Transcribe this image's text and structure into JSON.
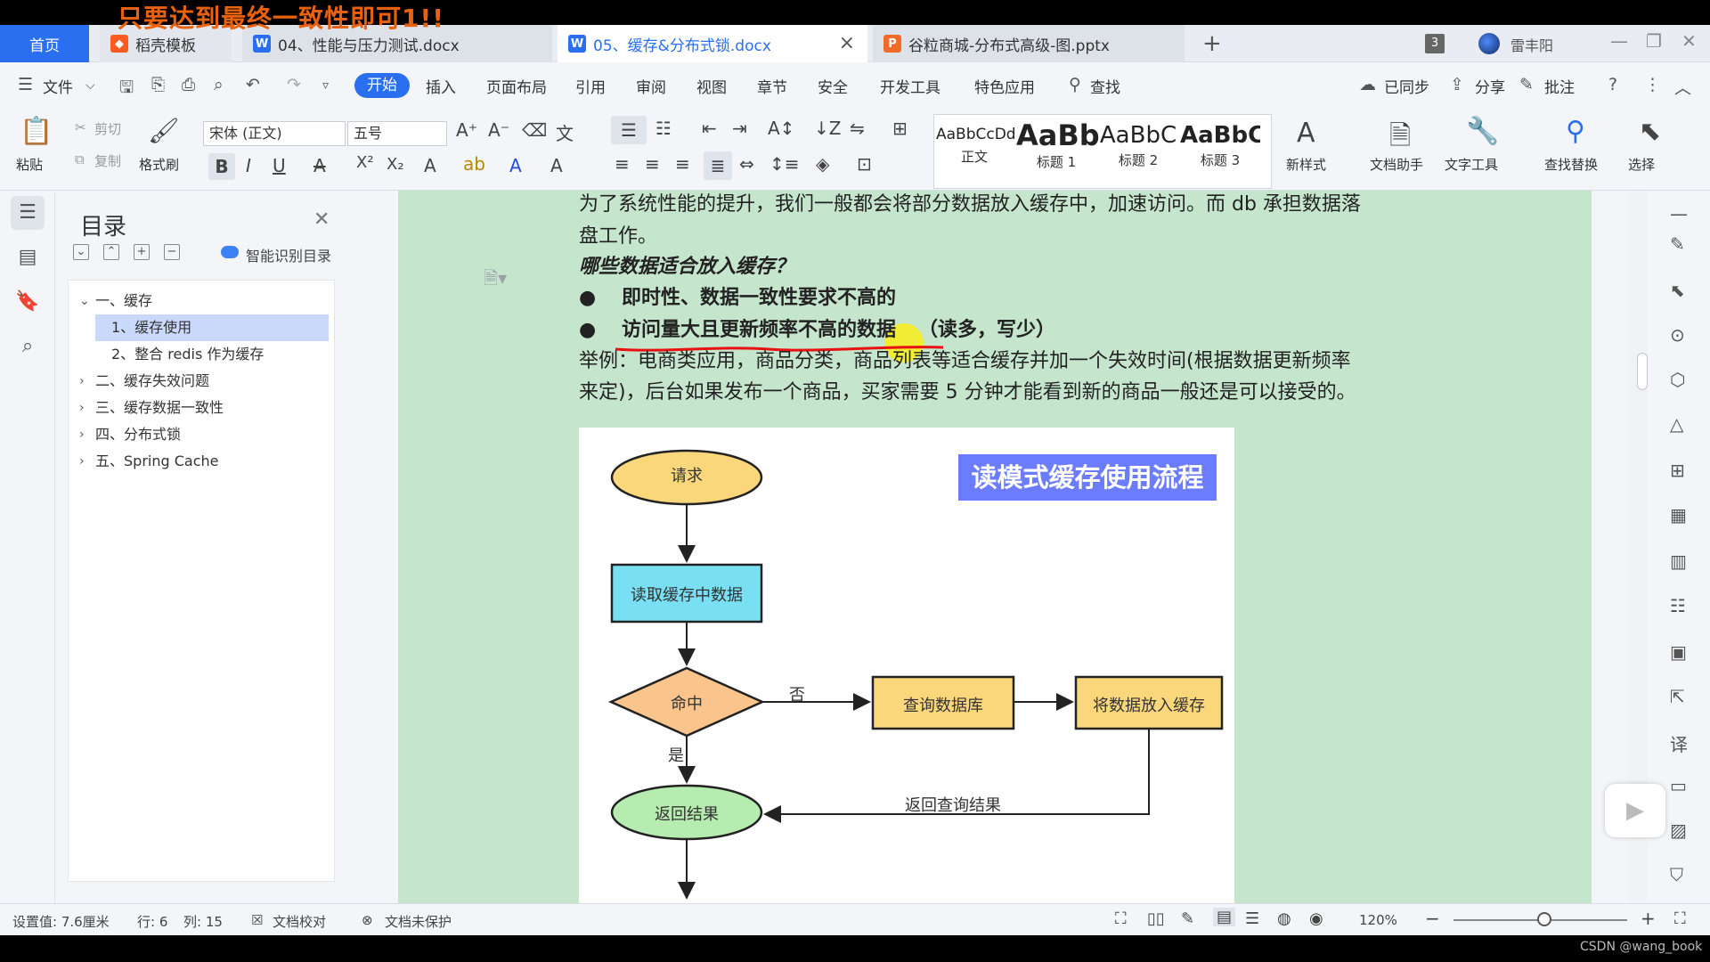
{
  "overlay_text": "只要达到最终一致性即可1!!",
  "tabs": {
    "home": "首页",
    "t1": "稻壳模板",
    "t2": "04、性能与压力测试.docx",
    "t3": "05、缓存&分布式锁.docx",
    "t4": "谷粒商城-分布式高级-图.pptx",
    "count": "3",
    "user": "雷丰阳"
  },
  "menu": {
    "file": "文件",
    "start": "开始",
    "insert": "插入",
    "layout": "页面布局",
    "ref": "引用",
    "review": "审阅",
    "view": "视图",
    "chapter": "章节",
    "security": "安全",
    "devtools": "开发工具",
    "special": "特色应用",
    "search": "查找",
    "synced": "已同步",
    "share": "分享",
    "comment": "批注"
  },
  "ribbon": {
    "paste": "粘贴",
    "cut": "剪切",
    "copy": "复制",
    "format_painter": "格式刷",
    "font_name": "宋体 (正文)",
    "font_size": "五号",
    "styles": [
      {
        "preview": "AaBbCcDd",
        "label": "正文"
      },
      {
        "preview": "AaBb",
        "label": "标题 1"
      },
      {
        "preview": "AaBbC",
        "label": "标题 2"
      },
      {
        "preview": "AaBbC",
        "label": "标题 3"
      }
    ],
    "new_style": "新样式",
    "doc_helper": "文档助手",
    "text_tools": "文字工具",
    "find_replace": "查找替换",
    "select": "选择"
  },
  "toc": {
    "title": "目录",
    "ai": "智能识别目录",
    "items": [
      "一、缓存",
      "1、缓存使用",
      "2、整合 redis 作为缓存",
      "二、缓存失效问题",
      "三、缓存数据一致性",
      "四、分布式锁",
      "五、Spring Cache"
    ]
  },
  "doc": {
    "line1": "为了系统性能的提升，我们一般都会将部分数据放入缓存中，加速访问。而 db 承担数据落",
    "line2": "盘工作。",
    "heading": "哪些数据适合放入缓存？",
    "bullet1": "即时性、数据一致性要求不高的",
    "bullet2": "访问量大且更新频率不高的数据",
    "bullet2_tail": "（读多，写少）",
    "example1": "举例：电商类应用，商品分类，商品列表等适合缓存并加一个失效时间(根据数据更新频率",
    "example2": "来定)，后台如果发布一个商品，买家需要 5 分钟才能看到新的商品一般还是可以接受的。"
  },
  "flowchart": {
    "title": "读模式缓存使用流程",
    "request": "请求",
    "read_cache": "读取缓存中数据",
    "hit": "命中",
    "no": "否",
    "yes": "是",
    "query_db": "查询数据库",
    "put_cache": "将数据放入缓存",
    "return_result": "返回结果",
    "return_query": "返回查询结果"
  },
  "status": {
    "setting": "设置值: 7.6厘米",
    "row": "行: 6",
    "col": "列: 15",
    "proof": "文档校对",
    "protect": "文档未保护",
    "zoom": "120%"
  },
  "watermark": "CSDN @wang_book",
  "colors": {
    "accent": "#2a6ff0",
    "page_bg": "#c6e5cd",
    "flow_title_bg": "#6b7cff"
  }
}
